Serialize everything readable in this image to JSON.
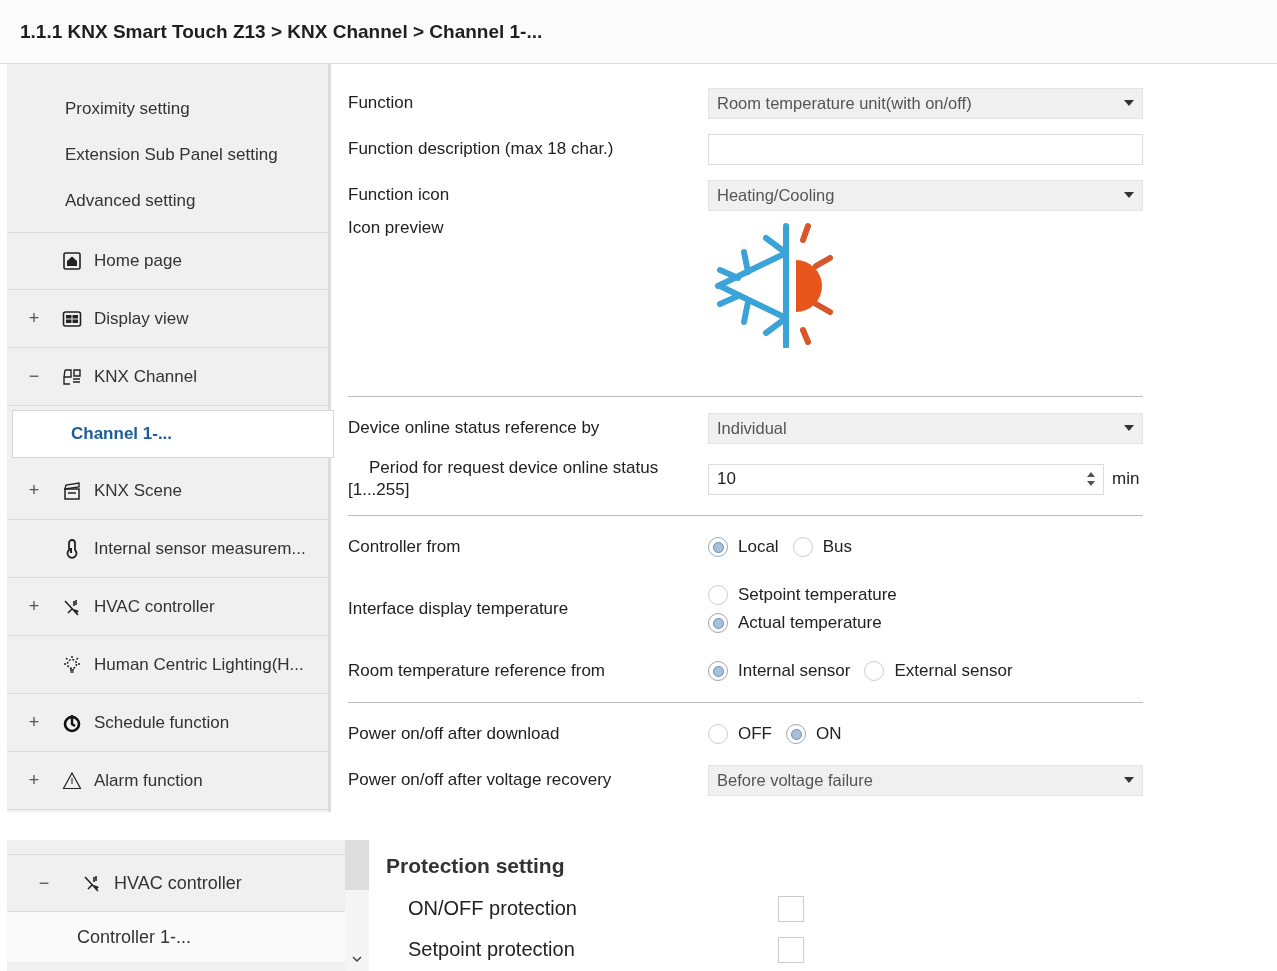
{
  "main_panel": {
    "breadcrumb": "1.1.1 KNX Smart Touch Z13 > KNX Channel  > Channel 1-...",
    "sidebar": {
      "items": [
        {
          "kind": "sub",
          "label": "Proximity setting",
          "selected": false
        },
        {
          "kind": "sub",
          "label": "Extension Sub Panel setting",
          "selected": false
        },
        {
          "kind": "sub",
          "label": "Advanced setting",
          "selected": false
        },
        {
          "kind": "group",
          "label": "Home page",
          "selected": false
        },
        {
          "kind": "group",
          "toggle": "+",
          "label": "Display view",
          "selected": false
        },
        {
          "kind": "group",
          "toggle": "−",
          "label": "KNX Channel",
          "selected": false
        },
        {
          "kind": "child",
          "label": "Channel 1-...",
          "selected": true
        },
        {
          "kind": "group",
          "toggle": "+",
          "label": "KNX Scene",
          "selected": false
        },
        {
          "kind": "group",
          "label": "Internal sensor measurem...",
          "selected": false
        },
        {
          "kind": "group",
          "toggle": "+",
          "label": "HVAC controller",
          "selected": false
        },
        {
          "kind": "group",
          "label": "Human Centric Lighting(H...",
          "selected": false
        },
        {
          "kind": "group",
          "toggle": "+",
          "label": "Schedule function",
          "selected": false
        },
        {
          "kind": "group",
          "toggle": "+",
          "label": "Alarm function",
          "selected": false
        }
      ]
    },
    "parameters": [
      {
        "kind": "dropdown",
        "label": "Function",
        "value": "Room temperature unit(with on/off)"
      },
      {
        "kind": "text",
        "label": "Function description (max 18 char.)"
      },
      {
        "kind": "dropdown",
        "label": "Function icon",
        "value": "Heating/Cooling"
      },
      {
        "kind": "preview",
        "label": "Icon preview"
      },
      {
        "kind": "divider"
      },
      {
        "kind": "dropdown",
        "label": "Device online status reference by",
        "value": "Individual"
      },
      {
        "kind": "spin",
        "label": "Period for request device online status\n[1...255]",
        "value": "10",
        "unit": "min"
      },
      {
        "kind": "divider"
      },
      {
        "kind": "radio_row",
        "label": "Controller from",
        "options": [
          {
            "label": "Local",
            "selected": true
          },
          {
            "label": "Bus",
            "selected": false
          }
        ]
      },
      {
        "kind": "radio_column",
        "label": "Interface display temperature",
        "options": [
          {
            "label": "Setpoint temperature",
            "selected": false
          },
          {
            "label": "Actual temperature",
            "selected": true
          }
        ]
      },
      {
        "kind": "radio_row",
        "label": "Room temperature reference from",
        "options": [
          {
            "label": "Internal sensor",
            "selected": true
          },
          {
            "label": "External sensor",
            "selected": false
          }
        ]
      },
      {
        "kind": "divider"
      },
      {
        "kind": "radio_row",
        "label": "Power on/off after download",
        "options": [
          {
            "label": "OFF",
            "selected": false
          },
          {
            "label": "ON",
            "selected": true
          }
        ]
      },
      {
        "kind": "dropdown",
        "label": "Power on/off after voltage recovery",
        "value": "Before voltage failure"
      }
    ]
  },
  "detail_panel": {
    "sidebar": {
      "items": [
        {
          "kind": "group",
          "toggle": "−",
          "label": "HVAC controller",
          "selected": false
        },
        {
          "kind": "child",
          "label": "Controller 1-...",
          "selected": false
        }
      ]
    },
    "section": {
      "title": "Protection setting",
      "items": [
        {
          "label": "ON/OFF protection",
          "checked": false
        },
        {
          "label": "Setpoint protection",
          "checked": false
        }
      ]
    }
  }
}
